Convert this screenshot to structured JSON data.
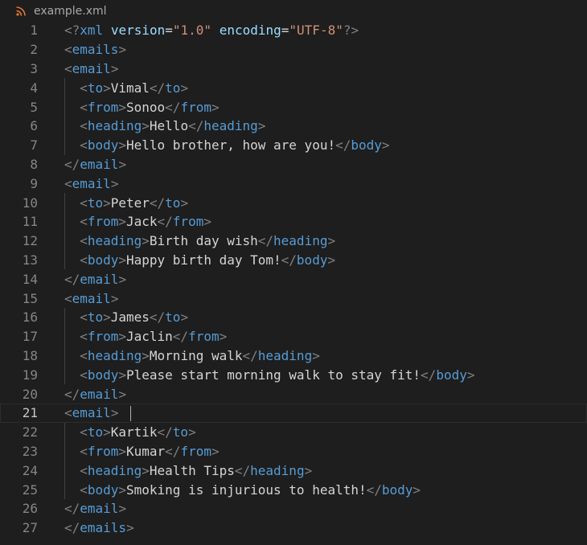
{
  "tab": {
    "filename": "example.xml",
    "icon": "rss-icon"
  },
  "colors": {
    "background": "#1e1e1e",
    "punctuation": "#808080",
    "tag": "#569cd6",
    "attribute": "#9cdcfe",
    "string": "#ce9178",
    "text": "#d4d4d4",
    "line_number": "#858585"
  },
  "editor": {
    "active_line": 21,
    "lines": [
      {
        "n": "1",
        "indent": 0,
        "tokens": [
          [
            "p",
            "<?"
          ],
          [
            "t",
            "xml"
          ],
          [
            "x",
            " "
          ],
          [
            "a",
            "version"
          ],
          [
            "x",
            "="
          ],
          [
            "s",
            "\"1.0\""
          ],
          [
            "x",
            " "
          ],
          [
            "a",
            "encoding"
          ],
          [
            "x",
            "="
          ],
          [
            "s",
            "\"UTF-8\""
          ],
          [
            "p",
            "?>"
          ]
        ]
      },
      {
        "n": "2",
        "indent": 0,
        "tokens": [
          [
            "p",
            "<"
          ],
          [
            "t",
            "emails"
          ],
          [
            "p",
            ">"
          ]
        ]
      },
      {
        "n": "3",
        "indent": 0,
        "tokens": [
          [
            "p",
            "<"
          ],
          [
            "t",
            "email"
          ],
          [
            "p",
            ">"
          ]
        ]
      },
      {
        "n": "4",
        "indent": 1,
        "tokens": [
          [
            "p",
            "<"
          ],
          [
            "t",
            "to"
          ],
          [
            "p",
            ">"
          ],
          [
            "x",
            "Vimal"
          ],
          [
            "p",
            "</"
          ],
          [
            "t",
            "to"
          ],
          [
            "p",
            ">"
          ]
        ]
      },
      {
        "n": "5",
        "indent": 1,
        "tokens": [
          [
            "p",
            "<"
          ],
          [
            "t",
            "from"
          ],
          [
            "p",
            ">"
          ],
          [
            "x",
            "Sonoo"
          ],
          [
            "p",
            "</"
          ],
          [
            "t",
            "from"
          ],
          [
            "p",
            ">"
          ]
        ]
      },
      {
        "n": "6",
        "indent": 1,
        "tokens": [
          [
            "p",
            "<"
          ],
          [
            "t",
            "heading"
          ],
          [
            "p",
            ">"
          ],
          [
            "x",
            "Hello"
          ],
          [
            "p",
            "</"
          ],
          [
            "t",
            "heading"
          ],
          [
            "p",
            ">"
          ]
        ]
      },
      {
        "n": "7",
        "indent": 1,
        "tokens": [
          [
            "p",
            "<"
          ],
          [
            "t",
            "body"
          ],
          [
            "p",
            ">"
          ],
          [
            "x",
            "Hello brother, how are you!"
          ],
          [
            "p",
            "</"
          ],
          [
            "t",
            "body"
          ],
          [
            "p",
            ">"
          ]
        ]
      },
      {
        "n": "8",
        "indent": 0,
        "tokens": [
          [
            "p",
            "</"
          ],
          [
            "t",
            "email"
          ],
          [
            "p",
            ">"
          ]
        ]
      },
      {
        "n": "9",
        "indent": 0,
        "tokens": [
          [
            "p",
            "<"
          ],
          [
            "t",
            "email"
          ],
          [
            "p",
            ">"
          ]
        ]
      },
      {
        "n": "10",
        "indent": 1,
        "tokens": [
          [
            "p",
            "<"
          ],
          [
            "t",
            "to"
          ],
          [
            "p",
            ">"
          ],
          [
            "x",
            "Peter"
          ],
          [
            "p",
            "</"
          ],
          [
            "t",
            "to"
          ],
          [
            "p",
            ">"
          ]
        ]
      },
      {
        "n": "11",
        "indent": 1,
        "tokens": [
          [
            "p",
            "<"
          ],
          [
            "t",
            "from"
          ],
          [
            "p",
            ">"
          ],
          [
            "x",
            "Jack"
          ],
          [
            "p",
            "</"
          ],
          [
            "t",
            "from"
          ],
          [
            "p",
            ">"
          ]
        ]
      },
      {
        "n": "12",
        "indent": 1,
        "tokens": [
          [
            "p",
            "<"
          ],
          [
            "t",
            "heading"
          ],
          [
            "p",
            ">"
          ],
          [
            "x",
            "Birth day wish"
          ],
          [
            "p",
            "</"
          ],
          [
            "t",
            "heading"
          ],
          [
            "p",
            ">"
          ]
        ]
      },
      {
        "n": "13",
        "indent": 1,
        "tokens": [
          [
            "p",
            "<"
          ],
          [
            "t",
            "body"
          ],
          [
            "p",
            ">"
          ],
          [
            "x",
            "Happy birth day Tom!"
          ],
          [
            "p",
            "</"
          ],
          [
            "t",
            "body"
          ],
          [
            "p",
            ">"
          ]
        ]
      },
      {
        "n": "14",
        "indent": 0,
        "tokens": [
          [
            "p",
            "</"
          ],
          [
            "t",
            "email"
          ],
          [
            "p",
            ">"
          ]
        ]
      },
      {
        "n": "15",
        "indent": 0,
        "tokens": [
          [
            "p",
            "<"
          ],
          [
            "t",
            "email"
          ],
          [
            "p",
            ">"
          ]
        ]
      },
      {
        "n": "16",
        "indent": 1,
        "tokens": [
          [
            "p",
            "<"
          ],
          [
            "t",
            "to"
          ],
          [
            "p",
            ">"
          ],
          [
            "x",
            "James"
          ],
          [
            "p",
            "</"
          ],
          [
            "t",
            "to"
          ],
          [
            "p",
            ">"
          ]
        ]
      },
      {
        "n": "17",
        "indent": 1,
        "tokens": [
          [
            "p",
            "<"
          ],
          [
            "t",
            "from"
          ],
          [
            "p",
            ">"
          ],
          [
            "x",
            "Jaclin"
          ],
          [
            "p",
            "</"
          ],
          [
            "t",
            "from"
          ],
          [
            "p",
            ">"
          ]
        ]
      },
      {
        "n": "18",
        "indent": 1,
        "tokens": [
          [
            "p",
            "<"
          ],
          [
            "t",
            "heading"
          ],
          [
            "p",
            ">"
          ],
          [
            "x",
            "Morning walk"
          ],
          [
            "p",
            "</"
          ],
          [
            "t",
            "heading"
          ],
          [
            "p",
            ">"
          ]
        ]
      },
      {
        "n": "19",
        "indent": 1,
        "tokens": [
          [
            "p",
            "<"
          ],
          [
            "t",
            "body"
          ],
          [
            "p",
            ">"
          ],
          [
            "x",
            "Please start morning walk to stay fit!"
          ],
          [
            "p",
            "</"
          ],
          [
            "t",
            "body"
          ],
          [
            "p",
            ">"
          ]
        ]
      },
      {
        "n": "20",
        "indent": 0,
        "tokens": [
          [
            "p",
            "</"
          ],
          [
            "t",
            "email"
          ],
          [
            "p",
            ">"
          ]
        ]
      },
      {
        "n": "21",
        "indent": 0,
        "tokens": [
          [
            "p",
            "<"
          ],
          [
            "t",
            "email"
          ],
          [
            "p",
            ">"
          ]
        ]
      },
      {
        "n": "22",
        "indent": 1,
        "tokens": [
          [
            "p",
            "<"
          ],
          [
            "t",
            "to"
          ],
          [
            "p",
            ">"
          ],
          [
            "x",
            "Kartik"
          ],
          [
            "p",
            "</"
          ],
          [
            "t",
            "to"
          ],
          [
            "p",
            ">"
          ]
        ]
      },
      {
        "n": "23",
        "indent": 1,
        "tokens": [
          [
            "p",
            "<"
          ],
          [
            "t",
            "from"
          ],
          [
            "p",
            ">"
          ],
          [
            "x",
            "Kumar"
          ],
          [
            "p",
            "</"
          ],
          [
            "t",
            "from"
          ],
          [
            "p",
            ">"
          ]
        ]
      },
      {
        "n": "24",
        "indent": 1,
        "tokens": [
          [
            "p",
            "<"
          ],
          [
            "t",
            "heading"
          ],
          [
            "p",
            ">"
          ],
          [
            "x",
            "Health Tips"
          ],
          [
            "p",
            "</"
          ],
          [
            "t",
            "heading"
          ],
          [
            "p",
            ">"
          ]
        ]
      },
      {
        "n": "25",
        "indent": 1,
        "tokens": [
          [
            "p",
            "<"
          ],
          [
            "t",
            "body"
          ],
          [
            "p",
            ">"
          ],
          [
            "x",
            "Smoking is injurious to health!"
          ],
          [
            "p",
            "</"
          ],
          [
            "t",
            "body"
          ],
          [
            "p",
            ">"
          ]
        ]
      },
      {
        "n": "26",
        "indent": 0,
        "tokens": [
          [
            "p",
            "</"
          ],
          [
            "t",
            "email"
          ],
          [
            "p",
            ">"
          ]
        ]
      },
      {
        "n": "27",
        "indent": 0,
        "tokens": [
          [
            "p",
            "</"
          ],
          [
            "t",
            "emails"
          ],
          [
            "p",
            ">"
          ]
        ]
      }
    ]
  }
}
